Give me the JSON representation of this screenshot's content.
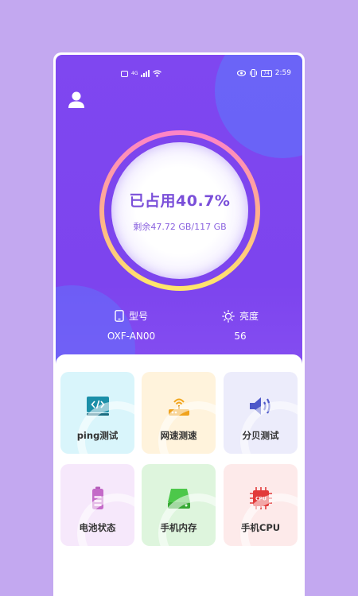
{
  "status_bar": {
    "left_icons": [
      "nfc-icon",
      "hd-4g-icon",
      "signal-icon",
      "wifi-icon"
    ],
    "network_label": "4G",
    "right_icons": [
      "eye-icon",
      "vibrate-icon",
      "battery-icon"
    ],
    "battery": "74",
    "time": "2:59"
  },
  "storage": {
    "used_label": "已占用40.7%",
    "remaining_label": "剩余47.72 GB/117 GB",
    "used_fraction": 0.407
  },
  "device_info": {
    "model_label": "型号",
    "model_value": "OXF-AN00",
    "brightness_label": "亮度",
    "brightness_value": "56"
  },
  "tools": [
    {
      "label": "ping测试",
      "icon": "code-icon"
    },
    {
      "label": "网速测速",
      "icon": "router-icon"
    },
    {
      "label": "分贝测试",
      "icon": "speaker-icon"
    },
    {
      "label": "电池状态",
      "icon": "battery-icon"
    },
    {
      "label": "手机内存",
      "icon": "storage-drive-icon"
    },
    {
      "label": "手机CPU",
      "icon": "cpu-icon"
    }
  ],
  "colors": {
    "page_bg": "#c3a8f0",
    "hero_purple": "#7d44ee",
    "accent_blob": "#646efa",
    "ring_gradient": [
      "#ff82c8",
      "#ffb38a",
      "#ffe86a"
    ],
    "text_purple": "#7a4fd9",
    "card_backgrounds": [
      "#d9f5fb",
      "#fff3dc",
      "#ececfb",
      "#f6e8fb",
      "#def5dd",
      "#fdeaea"
    ]
  }
}
